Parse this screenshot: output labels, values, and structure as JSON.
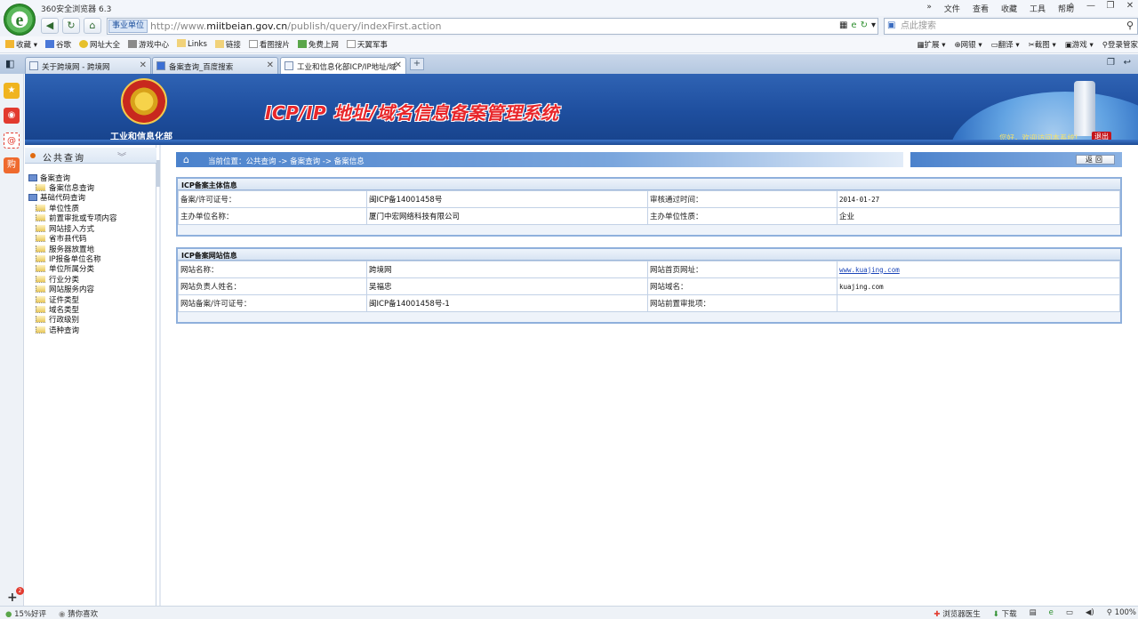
{
  "browser": {
    "app_title": "360安全浏览器 6.3",
    "logo_glyph": "e",
    "top_menu": [
      "»",
      "文件",
      "查看",
      "收藏",
      "工具",
      "帮助"
    ],
    "window_controls": [
      "⌂",
      "—",
      "❐",
      "✕"
    ],
    "address_tag": "事业单位",
    "url_prefix": "http://www.",
    "url_domain": "miitbeian.gov.cn",
    "url_path": "/publish/query/indexFirst.action",
    "search_placeholder": "点此搜索",
    "favorites": [
      "收藏",
      "谷歌",
      "网址大全",
      "游戏中心",
      "Links",
      "链接",
      "看图搜片",
      "免费上网",
      "天翼军事"
    ],
    "tools_right": [
      "扩展",
      "网银",
      "翻译",
      "截图",
      "游戏",
      "登录管家"
    ],
    "tabs": [
      {
        "label": "关于跨境网 - 跨境网"
      },
      {
        "label": "备案查询_百度搜索"
      },
      {
        "label": "工业和信息化部ICP/IP地址/域"
      }
    ],
    "new_tab": "+",
    "status_left": [
      "15%好评",
      "猜你喜欢"
    ],
    "status_right": [
      "浏览器医生",
      "下载",
      "100%"
    ]
  },
  "header": {
    "ministry": "工业和信息化部",
    "system_title": "ICP/IP 地址/域名信息备案管理系统",
    "welcome": "您好，欢迎访问本系统!",
    "logout": "退出"
  },
  "leftnav": {
    "title": "公共查询",
    "groups": [
      {
        "label": "备案查询",
        "items": [
          "备案信息查询"
        ]
      },
      {
        "label": "基础代码查询",
        "items": [
          "单位性质",
          "前置审批或专项内容",
          "网站接入方式",
          "省市县代码",
          "服务器放置地",
          "IP报备单位名称",
          "单位所属分类",
          "行业分类",
          "网站服务内容",
          "证件类型",
          "域名类型",
          "行政级别",
          "语种查询"
        ]
      }
    ]
  },
  "breadcrumb": {
    "text": "当前位置：公共查询  -> 备案查询  -> 备案信息",
    "return_label": "返回"
  },
  "subject_panel": {
    "title": "ICP备案主体信息",
    "rows": [
      {
        "l1": "备案/许可证号：",
        "v1": "闽ICP备14001458号",
        "l2": "审核通过时间：",
        "v2": "2014-01-27"
      },
      {
        "l1": "主办单位名称：",
        "v1": "厦门中宏网络科技有限公司",
        "l2": "主办单位性质：",
        "v2": "企业"
      }
    ]
  },
  "site_panel": {
    "title": "ICP备案网站信息",
    "rows": [
      {
        "l1": "网站名称：",
        "v1": "跨境网",
        "l2": "网站首页网址：",
        "v2": "www.kuajing.com"
      },
      {
        "l1": "网站负责人姓名：",
        "v1": "吴福忠",
        "l2": "网站域名：",
        "v2": "kuajing.com"
      },
      {
        "l1": "网站备案/许可证号：",
        "v1": "闽ICP备14001458号-1",
        "l2": "网站前置审批项：",
        "v2": ""
      }
    ]
  },
  "colors": {
    "banner_blue": "#1e4e9e",
    "title_red": "#e8262a",
    "link_blue": "#1a45b8"
  }
}
